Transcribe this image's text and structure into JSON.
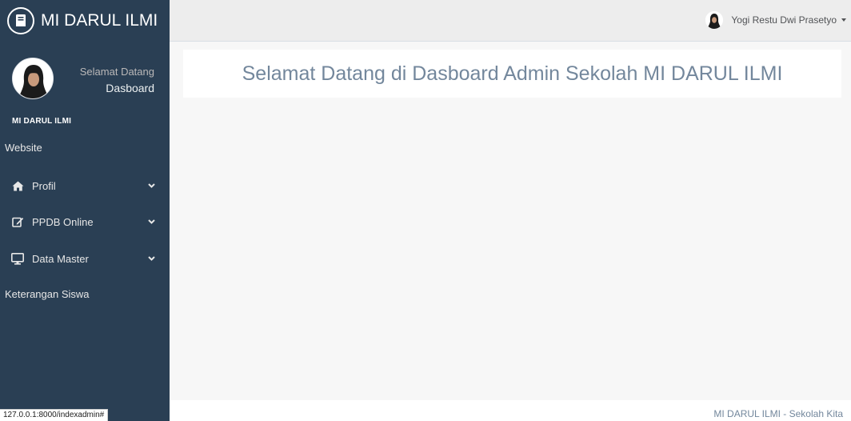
{
  "brand": {
    "title": "MI DARUL ILMI",
    "icon": "book-circle-icon"
  },
  "profile": {
    "welcome": "Selamat Datang",
    "subtitle": "Dasboard"
  },
  "sidebar": {
    "section_title": "MI DARUL ILMI",
    "items": [
      {
        "label": "Website",
        "icon": ""
      },
      {
        "label": "Profil",
        "icon": "home-icon",
        "has_submenu": true
      },
      {
        "label": "PPDB Online",
        "icon": "edit-icon",
        "has_submenu": true
      },
      {
        "label": "Data Master",
        "icon": "desktop-icon",
        "has_submenu": true
      },
      {
        "label": "Keterangan Siswa",
        "icon": ""
      }
    ]
  },
  "topnav": {
    "user_name": "Yogi Restu Dwi Prasetyo"
  },
  "main": {
    "heading": "Selamat Datang di Dasboard Admin Sekolah MI DARUL ILMI"
  },
  "footer": {
    "text": "MI DARUL ILMI - Sekolah Kita"
  },
  "statusbar": {
    "url": "127.0.0.1:8000/indexadmin#"
  },
  "colors": {
    "sidebar_bg": "#2a3f54",
    "nav_bg": "#ededed",
    "text": "#73879c"
  }
}
